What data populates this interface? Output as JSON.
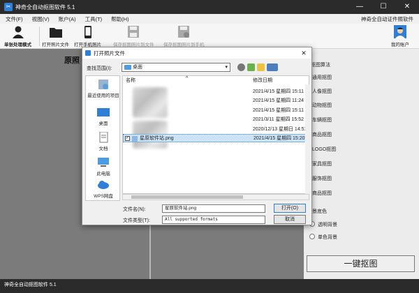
{
  "window": {
    "title": "神奇全自动抠图软件 5.1",
    "controls": [
      "—",
      "☐",
      "✕"
    ]
  },
  "menu": {
    "items": [
      "文件(F)",
      "视图(V)",
      "账户(A)",
      "工具(T)",
      "帮助(H)"
    ],
    "right_link": "神奇全自动证件照软件"
  },
  "toolbar": {
    "batch_mode": "单张处理模式",
    "open_image": "打开照片文件",
    "open_phone": "打开手机照片",
    "save_file": "保存抠图照片到文件",
    "save_phone": "保存抠图照片到手机",
    "account": "我的账户"
  },
  "main": {
    "original_label": "原照"
  },
  "right_panel": {
    "algo_title": "抠图算法",
    "algos": [
      "通用抠图",
      "人像抠图",
      "动物抠图",
      "车辆抠图",
      "商品抠图",
      "LOGO抠图",
      "家具抠图",
      "服饰抠图",
      "商品抠图"
    ],
    "bg_title": "景底色",
    "bg_options": [
      "透明背景",
      "单色背景"
    ],
    "onekey_button": "一键抠图"
  },
  "statusbar": {
    "text": "神奇全自动抠图软件 5.1"
  },
  "dialog": {
    "title": "打开照片文件",
    "lookin_label": "查找范围(I):",
    "lookin_value": "桌面",
    "places": [
      "最近使用的项目",
      "桌面",
      "文档",
      "此电脑",
      "WPS网盘"
    ],
    "columns": {
      "name": "名称",
      "date": "修改日期"
    },
    "files": [
      {
        "date": "2021/4/15 星期四 15:11"
      },
      {
        "date": "2021/4/15 星期四 11:24"
      },
      {
        "date": "2021/4/15 星期四 15:11"
      },
      {
        "date": "2021/3/11 星期四 15:52"
      },
      {
        "date": "2020/12/13 星期日 14:51"
      },
      {
        "name": "星原软件站.png",
        "date": "2021/4/15 星期四 15:20",
        "selected": true
      }
    ],
    "filename_label": "文件名(N):",
    "filename_value": "星原软件站.png",
    "filetype_label": "文件类型(T):",
    "filetype_value": "All supported formats",
    "open_button": "打开(O)",
    "cancel_button": "取消"
  },
  "colors": {
    "titlebar": "#2b2b2b",
    "accent": "#2f7fd8",
    "workarea": "#7b7b7b",
    "selection": "#cce4f7"
  }
}
